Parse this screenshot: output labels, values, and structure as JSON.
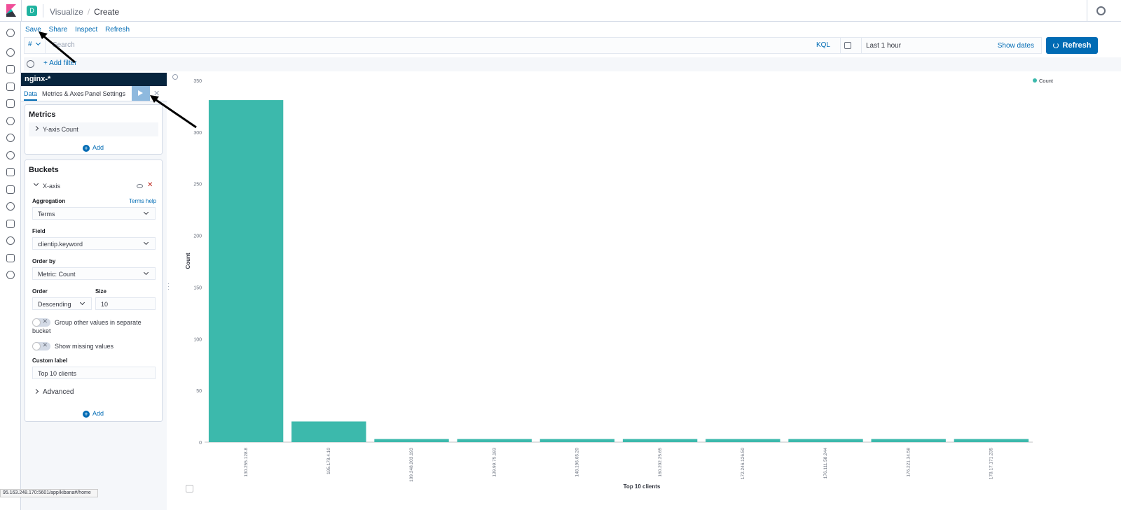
{
  "header": {
    "space_initial": "D",
    "breadcrumb_parent": "Visualize",
    "breadcrumb_current": "Create"
  },
  "top_menu": {
    "save": "Save",
    "share": "Share",
    "inspect": "Inspect",
    "refresh": "Refresh"
  },
  "query_bar": {
    "lang_symbol": "#",
    "placeholder": "Search",
    "kql": "KQL",
    "time_range": "Last 1 hour",
    "show_dates": "Show dates",
    "refresh_button": "Refresh"
  },
  "filter_bar": {
    "add_filter": "+ Add filter"
  },
  "editor": {
    "index_pattern": "nginx-*",
    "tabs": [
      "Data",
      "Metrics & Axes",
      "Panel Settings"
    ],
    "metrics": {
      "title": "Metrics",
      "item": "Y-axis Count",
      "add": "Add"
    },
    "buckets": {
      "title": "Buckets",
      "item": "X-axis",
      "aggregation_label": "Aggregation",
      "aggregation_help": "Terms help",
      "aggregation_value": "Terms",
      "field_label": "Field",
      "field_value": "clientip.keyword",
      "order_by_label": "Order by",
      "order_by_value": "Metric: Count",
      "order_label": "Order",
      "order_value": "Descending",
      "size_label": "Size",
      "size_value": "10",
      "group_other": "Group other values in separate bucket",
      "show_missing": "Show missing values",
      "custom_label_label": "Custom label",
      "custom_label_value": "Top 10 clients",
      "advanced": "Advanced",
      "add": "Add"
    }
  },
  "status_url": "95.163.248.170:5601/app/kibana#/home",
  "colors": {
    "accent": "#006bb4",
    "bar": "#3cb9ac",
    "index_bar": "#07253e"
  },
  "chart_data": {
    "type": "bar",
    "categories": [
      "130.255.128.8",
      "195.178.4.10",
      "109.248.203.193",
      "139.99.75.183",
      "148.196.65.20",
      "160.202.25.65",
      "172.246.126.50",
      "176.111.58.244",
      "176.221.34.58",
      "178.17.171.235"
    ],
    "values": [
      331,
      20,
      3,
      3,
      3,
      3,
      3,
      3,
      3,
      3
    ],
    "xlabel": "Top 10 clients",
    "ylabel": "Count",
    "ylim": [
      0,
      350
    ],
    "yticks": [
      0,
      50,
      100,
      150,
      200,
      250,
      300,
      350
    ],
    "legend": "Count",
    "legend_position": "top-right"
  }
}
